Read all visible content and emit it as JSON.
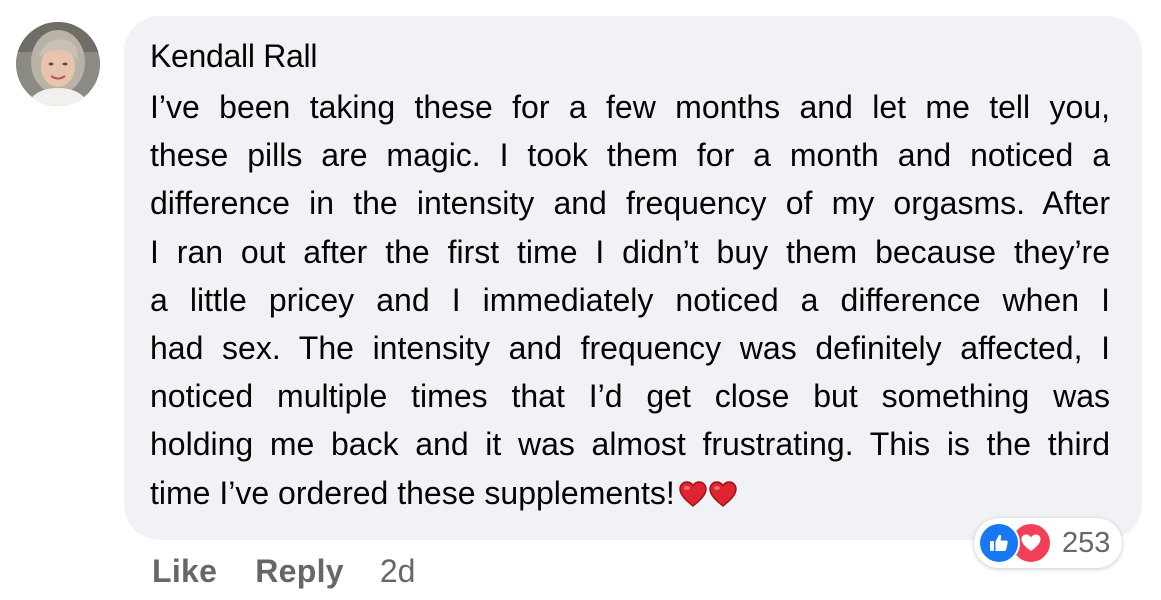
{
  "comment": {
    "author": "Kendall Rall",
    "text_lines": [
      "I’ve been taking these for a few months and let me tell you,",
      "these pills are magic. I took them for a month and noticed a",
      "difference in the intensity and frequency of my orgasms. After",
      "I ran out after the first time I didn’t buy them because they’re",
      "a little pricey and I immediately noticed a difference when I",
      "had sex. The intensity and frequency was definitely affected, I",
      "noticed multiple times that I’d get close but something was",
      "holding me back and it was almost frustrating. This is the third",
      "time I’ve ordered these supplements!"
    ],
    "emoji_icons": [
      "red-heart-icon",
      "red-heart-icon"
    ]
  },
  "reactions": {
    "icons": [
      "like-reaction-icon",
      "love-reaction-icon"
    ],
    "count": "253"
  },
  "actions": {
    "like_label": "Like",
    "reply_label": "Reply",
    "timestamp": "2d"
  },
  "colors": {
    "bubble_bg": "#f0f2f5",
    "text": "#050505",
    "secondary_text": "#65676b",
    "like_blue": "#1877f2",
    "love_red": "#f33e58",
    "heart_red": "#e0242f"
  }
}
